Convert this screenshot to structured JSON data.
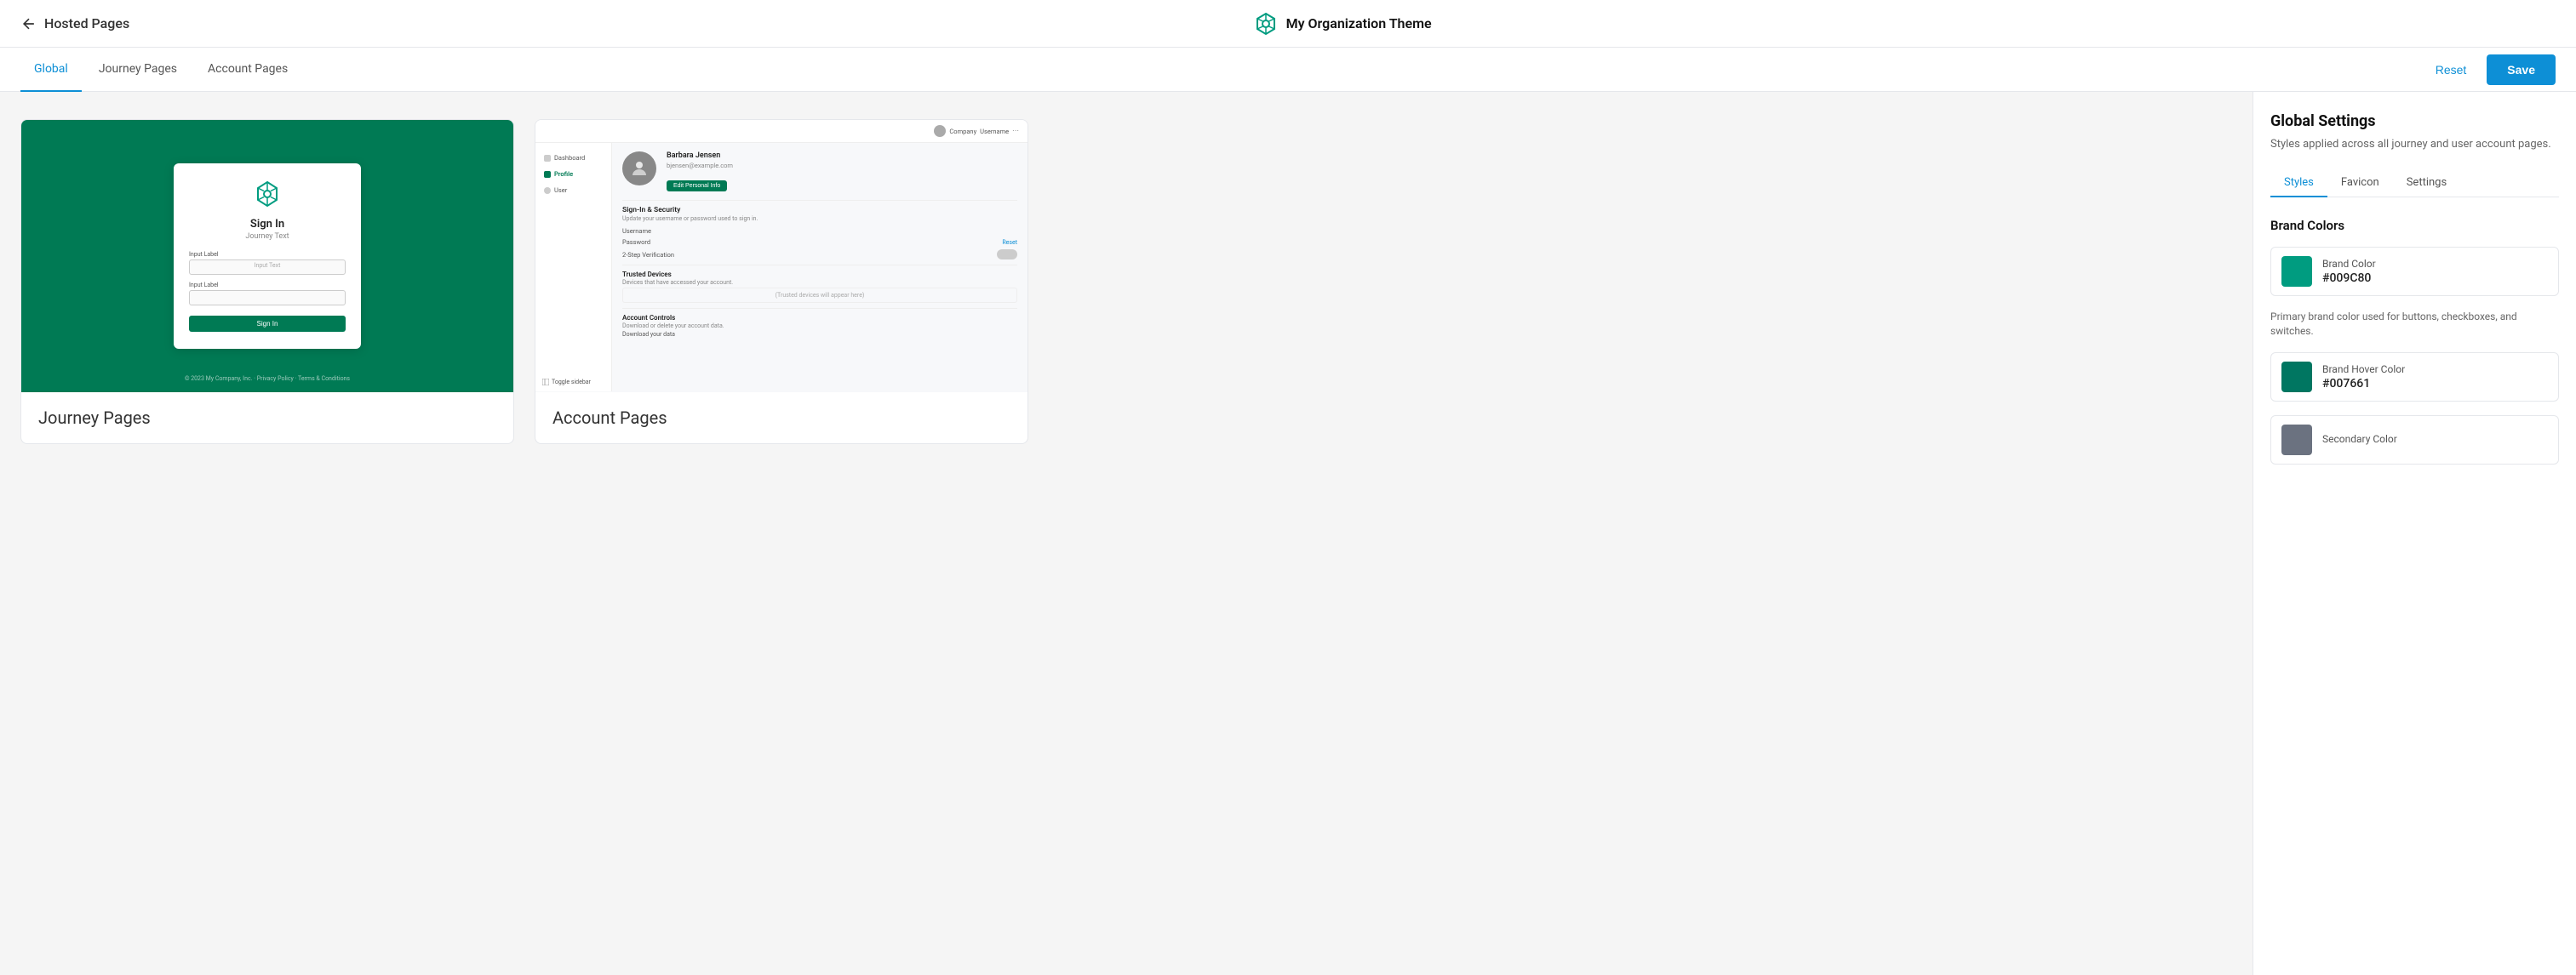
{
  "header": {
    "back_label": "Hosted Pages",
    "title": "My Organization Theme",
    "logo_alt": "organization-logo"
  },
  "tabs": {
    "items": [
      {
        "label": "Global",
        "active": true
      },
      {
        "label": "Journey Pages",
        "active": false
      },
      {
        "label": "Account Pages",
        "active": false
      }
    ],
    "reset_label": "Reset",
    "save_label": "Save"
  },
  "cards": [
    {
      "id": "journey",
      "label": "Journey Pages",
      "preview": "journey"
    },
    {
      "id": "account",
      "label": "Account Pages",
      "preview": "account"
    }
  ],
  "journey_preview": {
    "sign_in_title": "Sign In",
    "journey_text": "Journey Text",
    "input_label_1": "Input Label",
    "input_text_1": "Input Text",
    "input_label_2": "Input Label",
    "btn_label": "Sign In",
    "footer": "© 2023 My Company, Inc. · Privacy Policy · Terms & Conditions"
  },
  "account_preview": {
    "company": "Company",
    "username": "Username",
    "nav_dashboard": "Dashboard",
    "nav_profile": "Profile",
    "nav_user": "User",
    "user_name": "Barbara Jensen",
    "user_email": "bjensen@example.com",
    "edit_btn": "Edit Personal Info",
    "section_title": "Sign-In & Security",
    "section_desc": "Update your username or password used to sign in.",
    "field_username": "Username",
    "field_password": "Password",
    "reset_label": "Reset",
    "field_2step": "2-Step Verification",
    "trusted_devices_title": "Trusted Devices",
    "trusted_devices_desc": "Devices that have accessed your account.",
    "trusted_placeholder": "(Trusted devices will appear here)",
    "account_controls_title": "Account Controls",
    "account_controls_desc": "Download or delete your account data.",
    "download_data": "Download your data",
    "toggle_sidebar": "Toggle sidebar"
  },
  "right_panel": {
    "title": "Global Settings",
    "desc": "Styles applied across all journey and user account pages.",
    "tabs": [
      "Styles",
      "Favicon",
      "Settings"
    ],
    "active_tab": "Styles",
    "brand_colors_header": "Brand Colors",
    "brand_color": {
      "name": "Brand Color",
      "hex": "#009C80",
      "swatch": "#009C80"
    },
    "brand_color_desc": "Primary brand color used for buttons, checkboxes, and switches.",
    "brand_hover_color": {
      "name": "Brand Hover Color",
      "hex": "#007661",
      "swatch": "#007661"
    },
    "secondary_color": {
      "name": "Secondary Color",
      "swatch": "#6b7280"
    }
  }
}
